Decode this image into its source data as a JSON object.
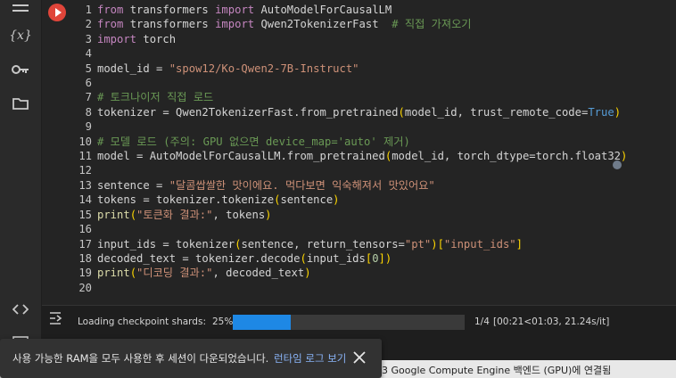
{
  "sidebar": {
    "icons": [
      "menu-icon",
      "variables-icon",
      "key-icon",
      "folder-icon",
      "code-icon",
      "terminal-icon"
    ],
    "variables_label": "{x}"
  },
  "code_lines": [
    [
      {
        "t": "from",
        "c": "kw"
      },
      {
        "t": " transformers ",
        "c": ""
      },
      {
        "t": "import",
        "c": "kw"
      },
      {
        "t": " AutoModelForCausalLM",
        "c": ""
      }
    ],
    [
      {
        "t": "from",
        "c": "kw"
      },
      {
        "t": " transformers ",
        "c": ""
      },
      {
        "t": "import",
        "c": "kw"
      },
      {
        "t": " Qwen2TokenizerFast  ",
        "c": ""
      },
      {
        "t": "# 직접 가져오기",
        "c": "cm"
      }
    ],
    [
      {
        "t": "import",
        "c": "kw"
      },
      {
        "t": " torch",
        "c": ""
      }
    ],
    [],
    [
      {
        "t": "model_id = ",
        "c": ""
      },
      {
        "t": "\"spow12/Ko-Qwen2-7B-Instruct\"",
        "c": "str"
      }
    ],
    [],
    [
      {
        "t": "# 토크나이저 직접 로드",
        "c": "cm"
      }
    ],
    [
      {
        "t": "tokenizer = Qwen2TokenizerFast.from_pretrained",
        "c": ""
      },
      {
        "t": "(",
        "c": "br"
      },
      {
        "t": "model_id, trust_remote_code=",
        "c": ""
      },
      {
        "t": "True",
        "c": "bool"
      },
      {
        "t": ")",
        "c": "br"
      }
    ],
    [],
    [
      {
        "t": "# 모델 로드 (주의: GPU 없으면 device_map='auto' 제거)",
        "c": "cm"
      }
    ],
    [
      {
        "t": "model = AutoModelForCausalLM.from_pretrained",
        "c": ""
      },
      {
        "t": "(",
        "c": "br"
      },
      {
        "t": "model_id, torch_dtype=torch.float32",
        "c": ""
      },
      {
        "t": ")",
        "c": "br"
      }
    ],
    [],
    [
      {
        "t": "sentence = ",
        "c": ""
      },
      {
        "t": "\"달콤쌉쌀한 맛이에요. 먹다보면 익숙해져서 맛있어요\"",
        "c": "str"
      }
    ],
    [
      {
        "t": "tokens = tokenizer.tokenize",
        "c": ""
      },
      {
        "t": "(",
        "c": "br"
      },
      {
        "t": "sentence",
        "c": ""
      },
      {
        "t": ")",
        "c": "br"
      }
    ],
    [
      {
        "t": "print",
        "c": "fn"
      },
      {
        "t": "(",
        "c": "br"
      },
      {
        "t": "\"토큰화 결과:\"",
        "c": "str"
      },
      {
        "t": ", tokens",
        "c": ""
      },
      {
        "t": ")",
        "c": "br"
      }
    ],
    [],
    [
      {
        "t": "input_ids = tokenizer",
        "c": ""
      },
      {
        "t": "(",
        "c": "br"
      },
      {
        "t": "sentence, return_tensors=",
        "c": ""
      },
      {
        "t": "\"pt\"",
        "c": "str"
      },
      {
        "t": ")",
        "c": "br"
      },
      {
        "t": "[",
        "c": "br"
      },
      {
        "t": "\"input_ids\"",
        "c": "str"
      },
      {
        "t": "]",
        "c": "br"
      }
    ],
    [
      {
        "t": "decoded_text = tokenizer.decode",
        "c": ""
      },
      {
        "t": "(",
        "c": "br"
      },
      {
        "t": "input_ids",
        "c": ""
      },
      {
        "t": "[",
        "c": "br"
      },
      {
        "t": "0",
        "c": "num"
      },
      {
        "t": "]",
        "c": "br"
      },
      {
        "t": ")",
        "c": "br"
      }
    ],
    [
      {
        "t": "print",
        "c": "fn"
      },
      {
        "t": "(",
        "c": "br"
      },
      {
        "t": "\"디코딩 결과:\"",
        "c": "str"
      },
      {
        "t": ", decoded_text",
        "c": ""
      },
      {
        "t": ")",
        "c": "br"
      }
    ],
    []
  ],
  "output": {
    "label": "Loading checkpoint shards:",
    "percent": "25%",
    "progress": 0.25,
    "count": "1/4",
    "timing": "[00:21<01:03,  21.24s/it]"
  },
  "status": {
    "text": "3 Google Compute Engine 백엔드 (GPU)에 연결됨"
  },
  "toast": {
    "message": "사용 가능한 RAM을 모두 사용한 후 세션이 다운되었습니다.",
    "link": "런타임 로그 보기"
  }
}
